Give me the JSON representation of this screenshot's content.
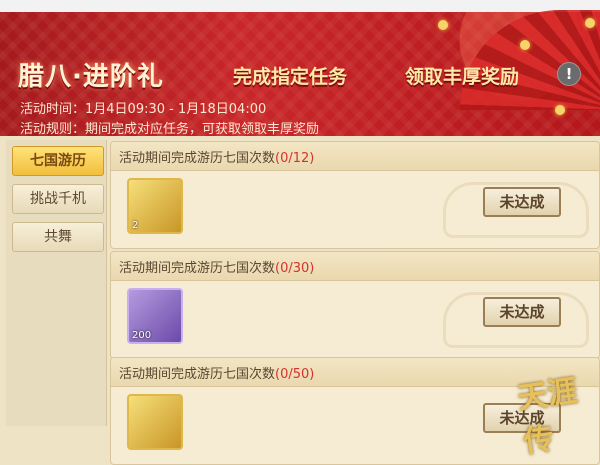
{
  "banner": {
    "title": "腊八·进阶礼",
    "subtitle_1": "完成指定任务",
    "subtitle_2": "领取丰厚奖励",
    "info_icon": "!",
    "time_text": "活动时间：1月4日09:30 - 1月18日04:00",
    "rule_text": "活动规则：期间完成对应任务，可获取领取丰厚奖励"
  },
  "tabs": [
    {
      "label": "七国游历",
      "active": true
    },
    {
      "label": "挑战千机",
      "active": false
    },
    {
      "label": "共舞",
      "active": false
    }
  ],
  "tasks": [
    {
      "desc": "活动期间完成游历七国次数",
      "progress": "(0/12)",
      "item_icon": "gold-token-icon",
      "item_count": "2",
      "status": "未达成"
    },
    {
      "desc": "活动期间完成游历七国次数",
      "progress": "(0/30)",
      "item_icon": "purple-emblem-icon",
      "item_count": "200",
      "status": "未达成"
    },
    {
      "desc": "活动期间完成游历七国次数",
      "progress": "(0/50)",
      "item_icon": "gold-token-icon",
      "item_count": "",
      "status": "未达成"
    }
  ],
  "logo_text": "天涯传"
}
